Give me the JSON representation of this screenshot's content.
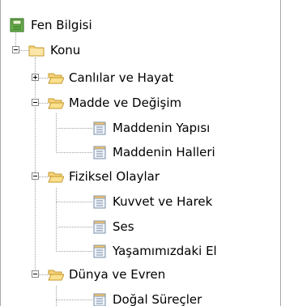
{
  "root": {
    "label": "Fen Bilgisi",
    "icon": "book-icon"
  },
  "konu": {
    "label": "Konu",
    "icon": "closed-folder-icon"
  },
  "folders": [
    {
      "label": "Canlılar ve Hayat",
      "state": "collapsed",
      "icon": "open-folder-icon"
    },
    {
      "label": "Madde ve Değişim",
      "state": "expanded",
      "icon": "open-folder-icon",
      "children": [
        "Maddenin Yapısı",
        "Maddenin Halleri"
      ]
    },
    {
      "label": "Fiziksel Olaylar",
      "state": "expanded",
      "icon": "open-folder-icon",
      "children": [
        "Kuvvet ve Harek",
        "Ses",
        "Yaşamımızdaki El"
      ]
    },
    {
      "label": "Dünya ve Evren",
      "state": "expanded",
      "icon": "open-folder-icon",
      "children": [
        "Doğal Süreçler"
      ]
    }
  ],
  "document_icon": "document-icon",
  "expander_icons": {
    "expanded": "minus-expander-icon",
    "collapsed": "plus-expander-icon"
  },
  "colors": {
    "tree_line": "#a0a0a0",
    "folder": "#f6d27a",
    "book": "#6ab04c"
  }
}
